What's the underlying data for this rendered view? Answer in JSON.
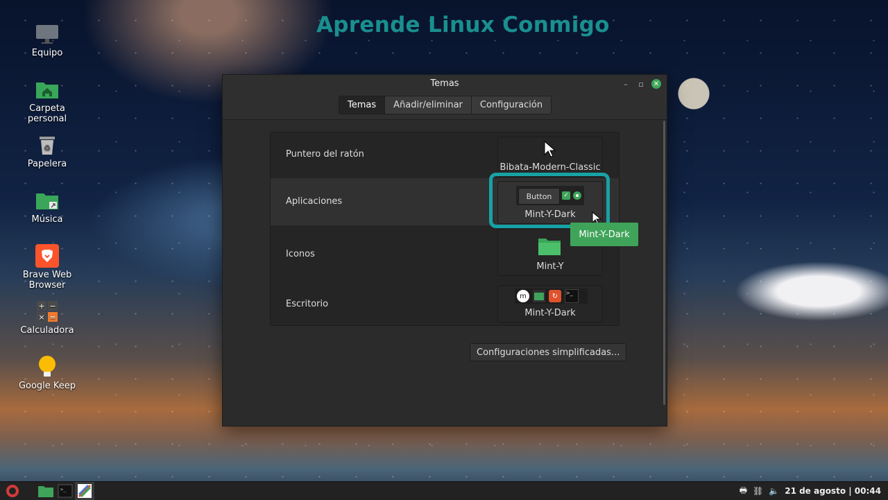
{
  "banner": "Aprende Linux Conmigo",
  "desktop_icons": [
    {
      "label": "Equipo"
    },
    {
      "label": "Carpeta personal"
    },
    {
      "label": "Papelera"
    },
    {
      "label": "Música"
    },
    {
      "label": "Brave Web Browser"
    },
    {
      "label": "Calculadora"
    },
    {
      "label": "Google Keep"
    }
  ],
  "window": {
    "title": "Temas",
    "tabs": [
      "Temas",
      "Añadir/eliminar",
      "Configuración"
    ],
    "rows": [
      {
        "label": "Puntero del ratón",
        "value": "Bibata-Modern-Classic"
      },
      {
        "label": "Aplicaciones",
        "value": "Mint-Y-Dark",
        "preview_button": "Button"
      },
      {
        "label": "Iconos",
        "value": "Mint-Y"
      },
      {
        "label": "Escritorio",
        "value": "Mint-Y-Dark"
      }
    ],
    "tooltip": "Mint-Y-Dark",
    "simple_button": "Configuraciones simplificadas..."
  },
  "taskbar": {
    "clock": "21 de agosto | 00:44"
  },
  "colors": {
    "accent_green": "#3fa459",
    "highlight_teal": "#17a2a6",
    "banner_teal": "#1a8f8f"
  }
}
